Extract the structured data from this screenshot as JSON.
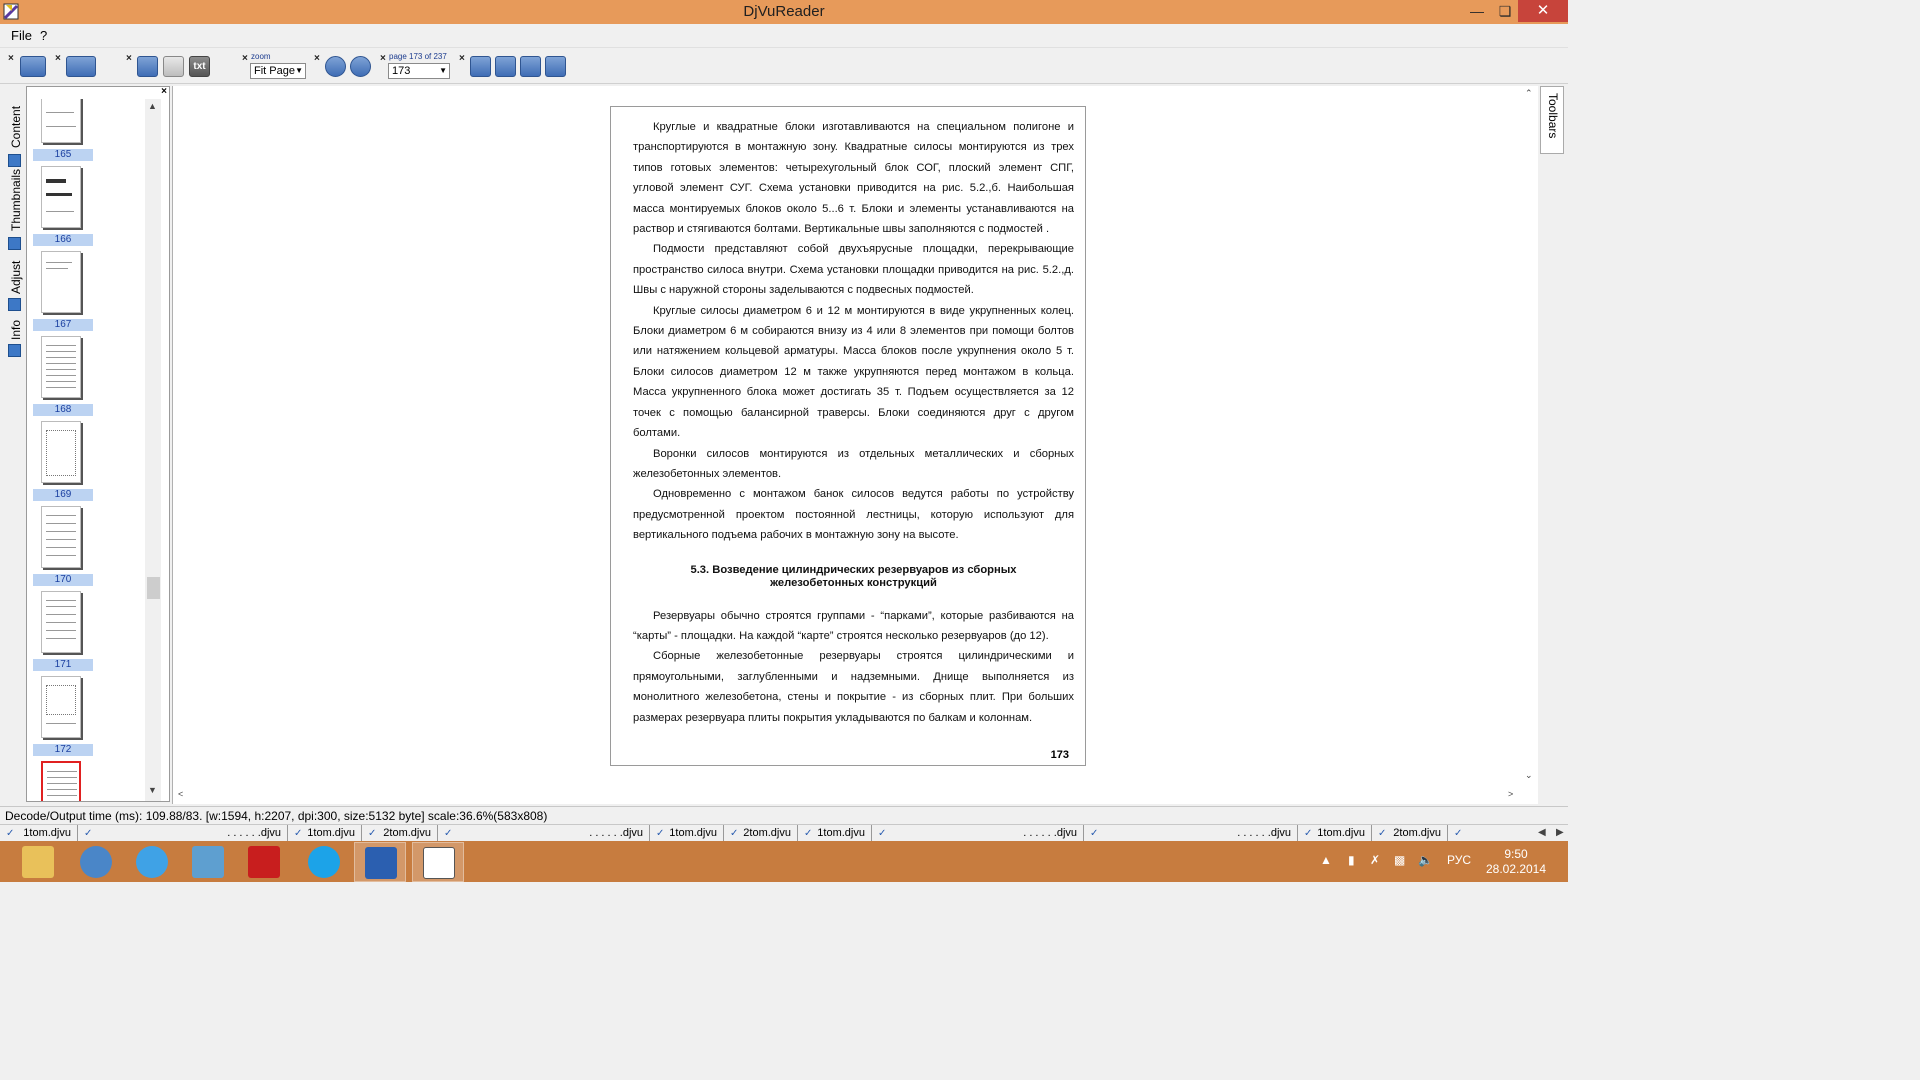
{
  "window": {
    "title": "DjVuReader"
  },
  "menu": {
    "file": "File",
    "help": "?"
  },
  "toolbar": {
    "text_mode_label": "txt",
    "zoom_label": "zoom",
    "zoom_value": "Fit Page",
    "page_label": "page 173 of 237",
    "page_value": "173"
  },
  "sidebar": {
    "tabs": [
      "Content",
      "Thumbnails",
      "Adjust",
      "Info"
    ],
    "thumbnails": [
      "165",
      "166",
      "167",
      "168",
      "169",
      "170",
      "171",
      "172"
    ]
  },
  "document": {
    "paragraphs": [
      "Круглые и квадратные блоки изготавливаются на специальном полигоне и транспортируются в монтажную зону. Квадратные силосы монтируются из трех типов готовых элементов: четырехугольный блок СОГ, плоский элемент СПГ, угловой элемент СУГ. Схема установки приводится на рис. 5.2.,б. Наибольшая масса монтируемых блоков около 5...6 т. Блоки и элементы устанавливаются на раствор и стягиваются болтами. Вертикальные швы заполняются с подмостей .",
      "Подмости представляют собой двухъярусные площадки, перекрывающие пространство силоса внутри. Схема установки площадки приводится на рис. 5.2.,д. Швы с наружной стороны заделываются с подвесных подмостей.",
      "Круглые силосы диаметром 6 и 12 м монтируются в виде укрупненных колец. Блоки диаметром 6 м собираются внизу из 4 или 8 элементов при помощи болтов или натяжением кольцевой арматуры. Масса блоков после укрупнения около 5 т. Блоки силосов диаметром 12 м также укрупняются перед монтажом в кольца. Масса укрупненного блока может достигать 35 т. Подъем осуществляется за 12 точек с помощью балансирной траверсы. Блоки соединяются друг с другом болтами.",
      "Воронки силосов монтируются из отдельных металлических и сборных железобетонных элементов.",
      "Одновременно с монтажом банок силосов ведутся работы по устройству предусмотренной проектом постоянной лестницы, которую используют для вертикального подъема рабочих в монтажную зону на высоте."
    ],
    "heading_line1": "5.3.  Возведение цилиндрических  резервуаров из сборных",
    "heading_line2": "железобетонных  конструкций",
    "paragraphs2": [
      "Резервуары обычно строятся группами - “парками”, которые разбиваются на “карты” - площадки. На каждой “карте” строятся несколько резервуаров (до 12).",
      "Сборные железобетонные резервуары строятся цилиндрическими и прямоугольными, заглубленными и надземными. Днище выполняется из монолитного железобетона, стены и покрытие - из сборных плит. При больших размерах резервуара плиты покрытия укладываются по балкам и колоннам."
    ],
    "page_number": "173"
  },
  "right_tab": "Toolbars",
  "status": "Decode/Output time (ms): 109.88/83. [w:1594, h:2207, dpi:300, size:5132 byte] scale:36.6%(583x808)",
  "doc_tabs": [
    {
      "name": "1tom.djvu"
    },
    {
      "name": ". . .         . .       .djvu"
    },
    {
      "name": "1tom.djvu"
    },
    {
      "name": "2tom.djvu"
    },
    {
      "name": ". . .         . .       .djvu"
    },
    {
      "name": "1tom.djvu"
    },
    {
      "name": "2tom.djvu"
    },
    {
      "name": "1tom.djvu"
    },
    {
      "name": ". . .         . .       .djvu"
    },
    {
      "name": ". . .         . .       .djvu"
    },
    {
      "name": "1tom.djvu"
    },
    {
      "name": "2tom.djvu"
    }
  ],
  "taskbar": {
    "language": "РУС",
    "time": "9:50",
    "date": "28.02.2014",
    "apps": [
      "file-explorer",
      "audio-player",
      "internet-explorer",
      "photo-viewer",
      "adobe-reader",
      "skype",
      "microsoft-word",
      "djvu-reader"
    ]
  }
}
